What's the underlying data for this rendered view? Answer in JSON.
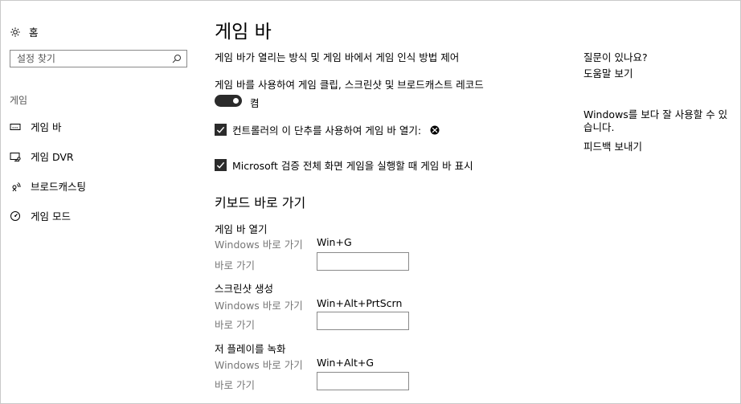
{
  "sidebar": {
    "home_label": "홈",
    "search_placeholder": "설정 찾기",
    "section_label": "게임",
    "items": [
      {
        "label": "게임 바",
        "icon": "game-bar-icon"
      },
      {
        "label": "게임 DVR",
        "icon": "game-dvr-icon"
      },
      {
        "label": "브로드캐스팅",
        "icon": "broadcasting-icon"
      },
      {
        "label": "게임 모드",
        "icon": "game-mode-icon"
      }
    ]
  },
  "main": {
    "title": "게임 바",
    "description": "게임 바가 열리는 방식 및 게임 바에서 게임 인식 방법 제어",
    "record_label": "게임 바를 사용하여 게임 클립, 스크린샷 및 브로드캐스트 레코드",
    "toggle": {
      "label": "켬",
      "on": true
    },
    "checkbox_controller": {
      "label": "컨트롤러의 이 단추를 사용하여 게임 바 열기:",
      "checked": true,
      "icon": "xbox-icon"
    },
    "checkbox_fullscreen": {
      "label": "Microsoft 검증 전체 화면 게임을 실행할 때 게임 바 표시",
      "checked": true
    },
    "shortcuts_title": "키보드 바로 가기",
    "shortcuts": [
      {
        "title": "게임 바 열기",
        "windows_label": "Windows 바로 가기",
        "windows_value": "Win+G",
        "custom_label": "바로 가기",
        "custom_value": ""
      },
      {
        "title": "스크린샷 생성",
        "windows_label": "Windows 바로 가기",
        "windows_value": "Win+Alt+PrtScrn",
        "custom_label": "바로 가기",
        "custom_value": ""
      },
      {
        "title": "저 플레이를 녹화",
        "windows_label": "Windows 바로 가기",
        "windows_value": "Win+Alt+G",
        "custom_label": "바로 가기",
        "custom_value": ""
      }
    ]
  },
  "aside": {
    "question_heading": "질문이 있나요?",
    "help_link": "도움말 보기",
    "improve_text": "Windows를 보다 잘 사용할 수 있습니다.",
    "feedback_link": "피드백 보내기"
  }
}
